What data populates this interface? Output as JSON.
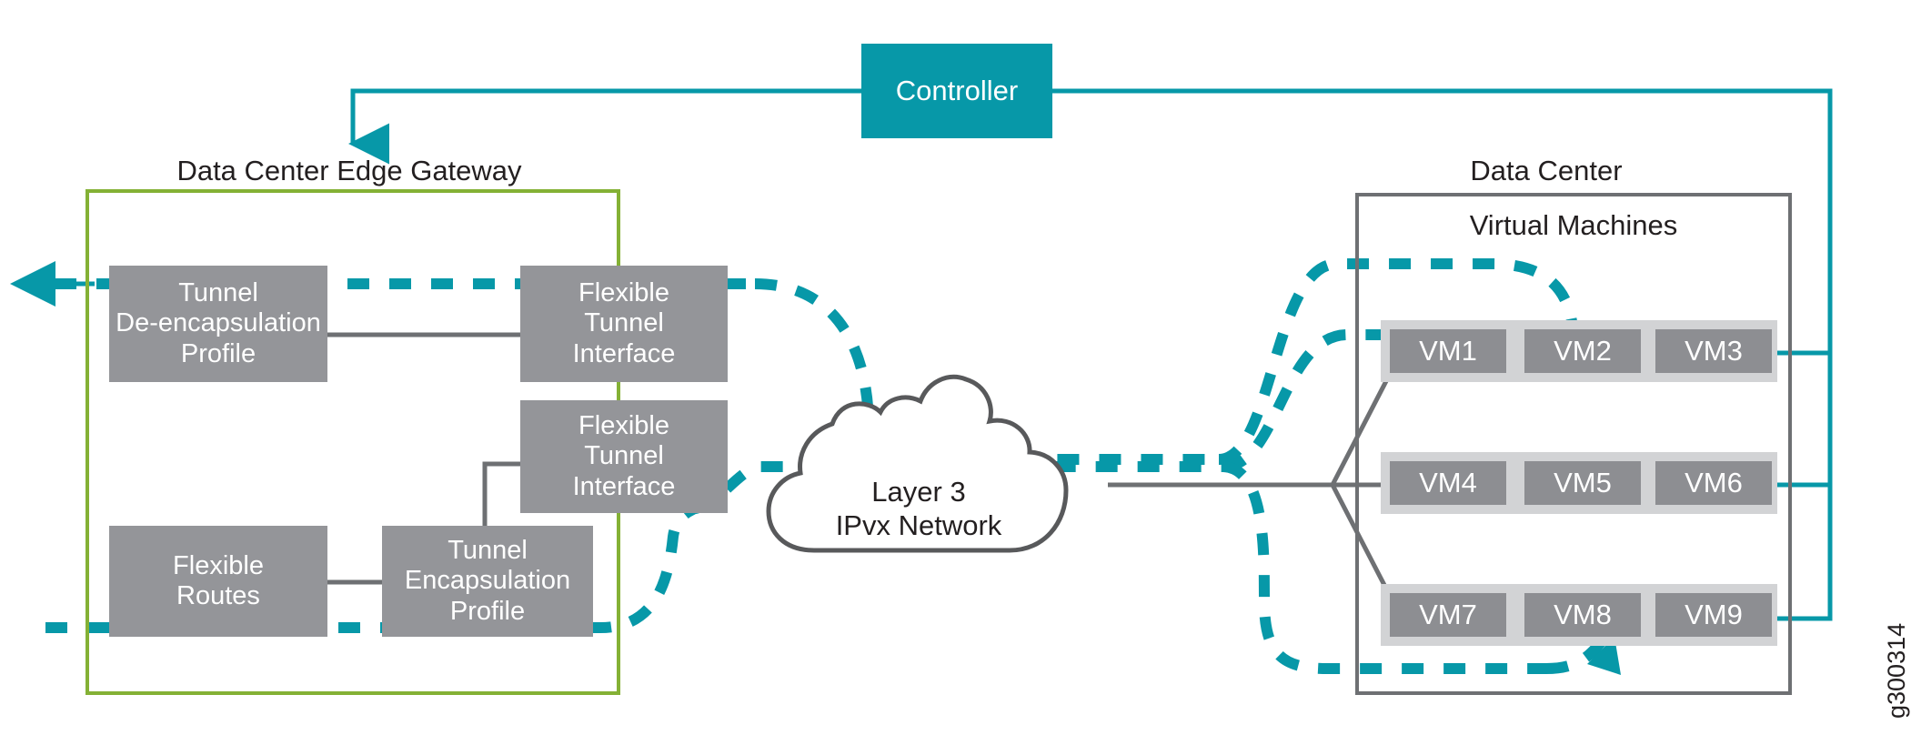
{
  "figure": {
    "id_label": "g300314",
    "colors": {
      "teal": "#0798a8",
      "green": "#84b135",
      "gray_box": "#949599",
      "vm_box": "#8d8e92",
      "vm_strip": "#d2d3d5",
      "outline_gray": "#6e7073",
      "text_dark": "#231f20",
      "text_light": "#ffffff",
      "background": "#ffffff"
    }
  },
  "controller": {
    "label": "Controller"
  },
  "edge_gateway": {
    "title": "Data Center Edge Gateway",
    "boxes": [
      {
        "label": "Tunnel\nDe-encapsulation\nProfile"
      },
      {
        "label": "Flexible\nTunnel\nInterface"
      },
      {
        "label": "Flexible\nTunnel\nInterface"
      },
      {
        "label": "Flexible\nRoutes"
      },
      {
        "label": "Tunnel\nEncapsulation\nProfile"
      }
    ],
    "box_tunnel_deencap": "Tunnel\nDe-encapsulation\nProfile",
    "box_fti_top": "Flexible\nTunnel\nInterface",
    "box_fti_bottom": "Flexible\nTunnel\nInterface",
    "box_flexible_routes": "Flexible\nRoutes",
    "box_tunnel_encap": "Tunnel\nEncapsulation\nProfile"
  },
  "network_cloud": {
    "line1": "Layer 3",
    "line2": "IPvx Network"
  },
  "data_center": {
    "title": "Data Center",
    "subtitle": "Virtual Machines",
    "rows": [
      {
        "vms": [
          "VM1",
          "VM2",
          "VM3"
        ]
      },
      {
        "vms": [
          "VM4",
          "VM5",
          "VM6"
        ]
      },
      {
        "vms": [
          "VM7",
          "VM8",
          "VM9"
        ]
      }
    ],
    "vm_labels": {
      "r0c0": "VM1",
      "r0c1": "VM2",
      "r0c2": "VM3",
      "r1c0": "VM4",
      "r1c1": "VM5",
      "r1c2": "VM6",
      "r2c0": "VM7",
      "r2c1": "VM8",
      "r2c2": "VM9"
    }
  }
}
